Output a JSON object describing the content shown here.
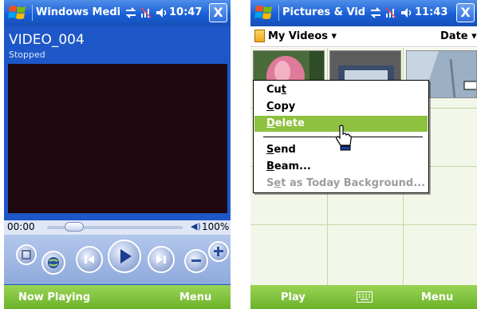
{
  "left": {
    "titlebar": {
      "title": "Windows Medi",
      "time": "10:47",
      "close_label": "X"
    },
    "video": {
      "title": "VIDEO_004",
      "status": "Stopped"
    },
    "seek": {
      "time": "00:00",
      "volume_pct": "100%",
      "position_fraction": 0.0
    },
    "softkeys": {
      "left": "Now Playing",
      "right": "Menu"
    }
  },
  "right": {
    "titlebar": {
      "title": "Pictures & Vid",
      "time": "11:43",
      "close_label": "X"
    },
    "header": {
      "folder": "My Videos ▾",
      "sort": "Date ▾"
    },
    "context_menu": {
      "items": [
        {
          "label_pre": "Cu",
          "label_u": "t",
          "label_post": ""
        },
        {
          "label_pre": "",
          "label_u": "C",
          "label_post": "opy"
        },
        {
          "label_pre": "",
          "label_u": "D",
          "label_post": "elete"
        },
        {
          "label_pre": "",
          "label_u": "S",
          "label_post": "end"
        },
        {
          "label_pre": "",
          "label_u": "B",
          "label_post": "eam..."
        },
        {
          "label_pre": "S",
          "label_u": "e",
          "label_post": "t as Today Background..."
        }
      ],
      "selected": "Delete",
      "disabled": "Set as Today Background..."
    },
    "softkeys": {
      "left": "Play",
      "center_icon": "keyboard-icon",
      "right": "Menu"
    }
  },
  "colors": {
    "titlebar_blue": "#1a5fd6",
    "player_bg": "#1d57c8",
    "softkey_green": "#7cc033",
    "menu_highlight": "#8ec13f"
  }
}
